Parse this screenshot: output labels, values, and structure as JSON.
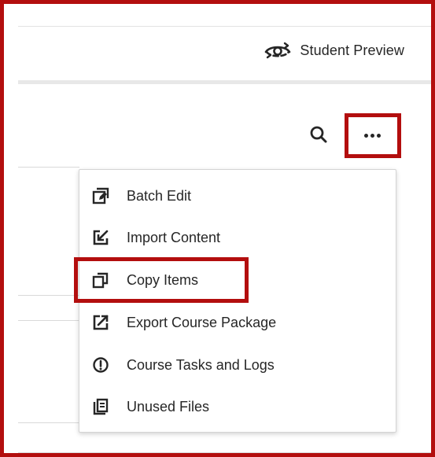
{
  "header": {
    "student_preview_label": "Student Preview"
  },
  "toolbar": {
    "search_icon": "search-icon",
    "more_icon": "more-horizontal-icon"
  },
  "menu": {
    "items": [
      {
        "label": "Batch Edit",
        "icon": "batch-edit-icon"
      },
      {
        "label": "Import Content",
        "icon": "import-content-icon"
      },
      {
        "label": "Copy Items",
        "icon": "copy-items-icon",
        "highlighted": true
      },
      {
        "label": "Export Course Package",
        "icon": "export-icon"
      },
      {
        "label": "Course Tasks and Logs",
        "icon": "alert-circle-icon"
      },
      {
        "label": "Unused Files",
        "icon": "unused-files-icon"
      }
    ]
  },
  "colors": {
    "highlight": "#b30e0e",
    "text": "#262626"
  }
}
